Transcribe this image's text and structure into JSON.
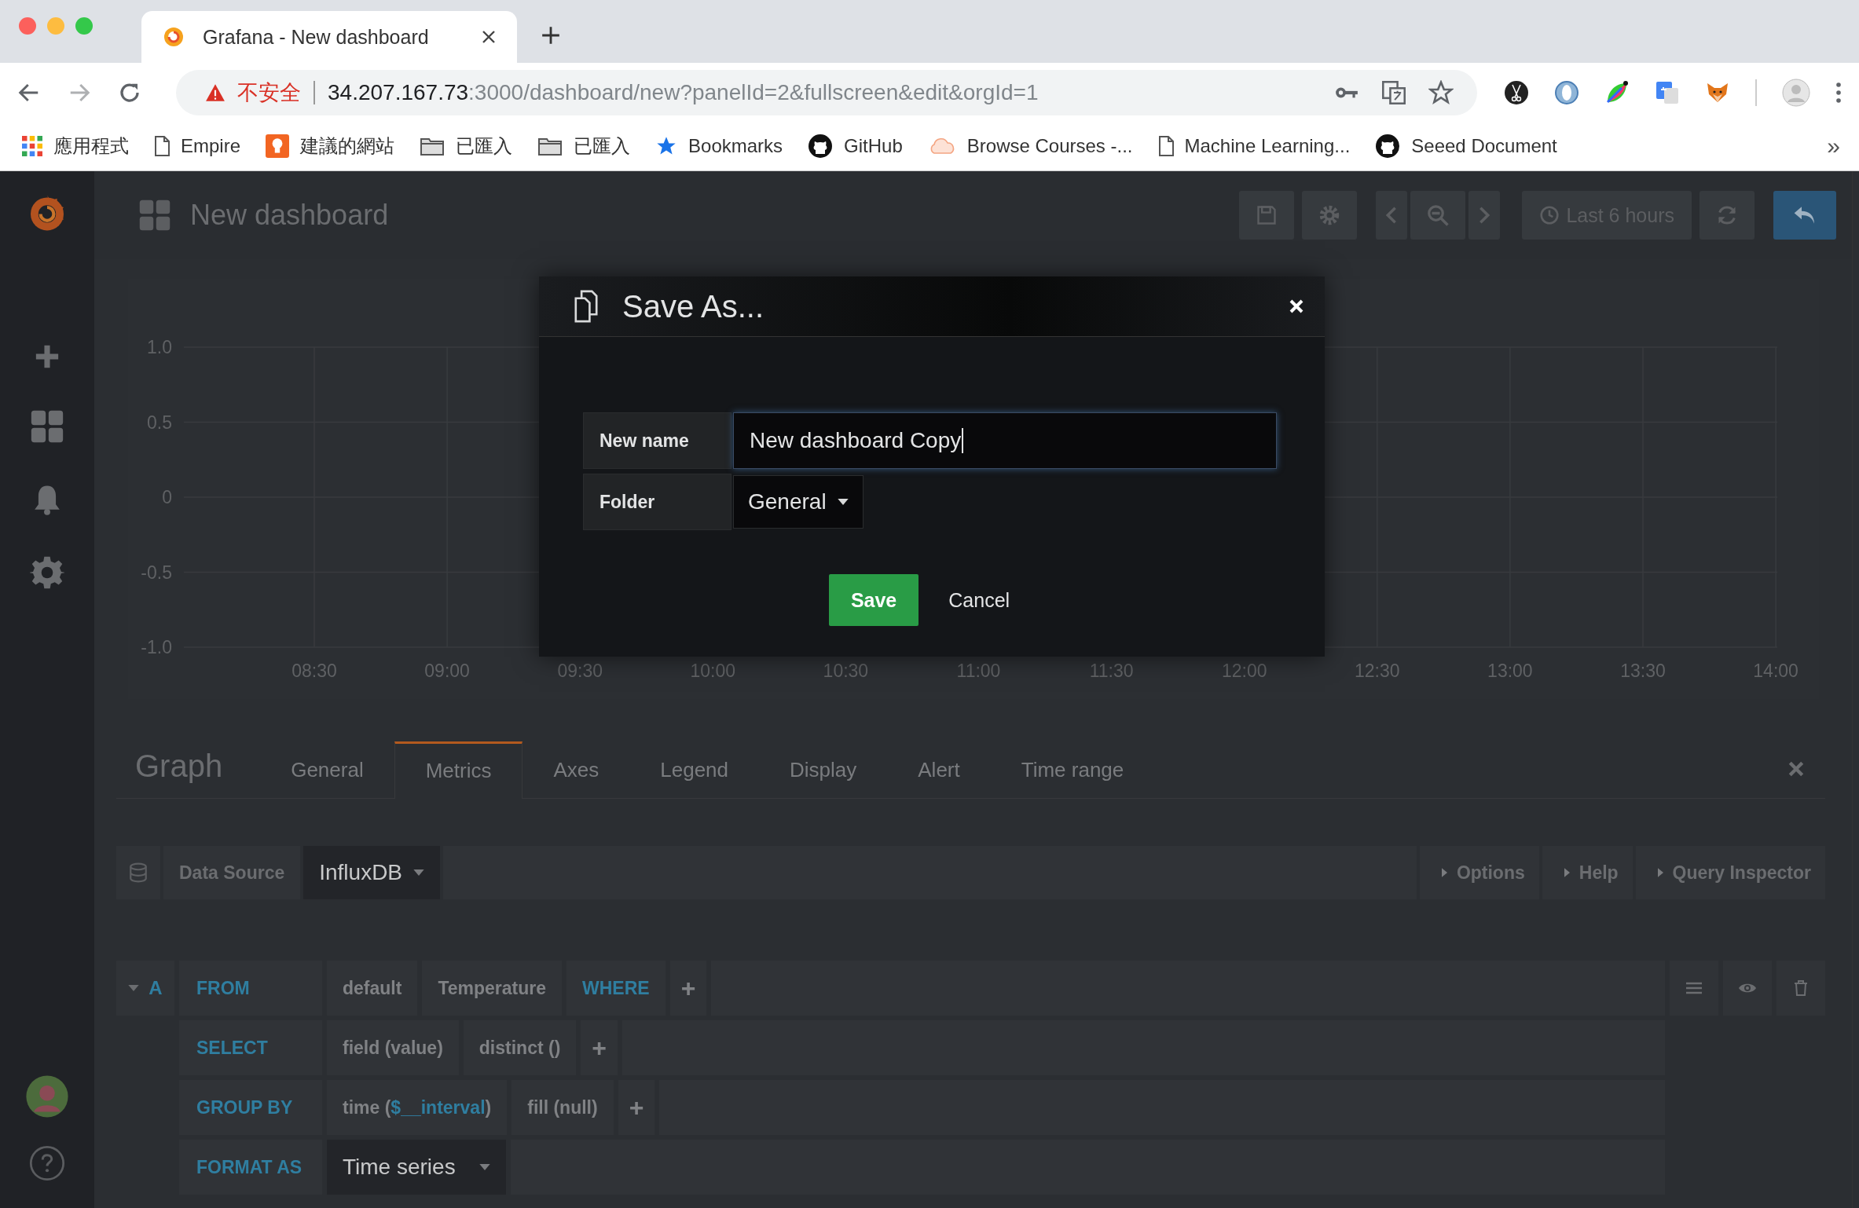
{
  "browser": {
    "tab": {
      "title": "Grafana - New dashboard"
    },
    "nav": {
      "back_disabled": false,
      "forward_disabled": true
    },
    "security": "不安全",
    "url_host": "34.207.167.73",
    "url_rest": ":3000/dashboard/new?panelId=2&fullscreen&edit&orgId=1",
    "bookmarks": [
      {
        "kind": "apps",
        "label": "應用程式"
      },
      {
        "kind": "page",
        "label": "Empire"
      },
      {
        "kind": "bulb",
        "label": "建議的網站"
      },
      {
        "kind": "folder",
        "label": "已匯入"
      },
      {
        "kind": "folder",
        "label": "已匯入"
      },
      {
        "kind": "star",
        "label": "Bookmarks"
      },
      {
        "kind": "github",
        "label": "GitHub"
      },
      {
        "kind": "cloud",
        "label": "Browse Courses -..."
      },
      {
        "kind": "page",
        "label": "Machine Learning..."
      },
      {
        "kind": "github",
        "label": "Seeed Document"
      }
    ],
    "more": "»"
  },
  "dashboard": {
    "title": "New dashboard",
    "time_range": "Last 6 hours"
  },
  "graph": {
    "y_labels": [
      "1.0",
      "0.5",
      "0",
      "-0.5",
      "-1.0"
    ],
    "x_labels": [
      "08:30",
      "09:00",
      "09:30",
      "10:00",
      "10:30",
      "11:00",
      "11:30",
      "12:00",
      "12:30",
      "13:00",
      "13:30",
      "14:00"
    ]
  },
  "editor": {
    "title": "Graph",
    "tabs": [
      {
        "label": "General",
        "selected": false
      },
      {
        "label": "Metrics",
        "selected": true
      },
      {
        "label": "Axes",
        "selected": false
      },
      {
        "label": "Legend",
        "selected": false
      },
      {
        "label": "Display",
        "selected": false
      },
      {
        "label": "Alert",
        "selected": false
      },
      {
        "label": "Time range",
        "selected": false
      }
    ],
    "data_source_label": "Data Source",
    "data_source": "InfluxDB",
    "toggles": [
      "Options",
      "Help",
      "Query Inspector"
    ],
    "query": {
      "ref": "A",
      "expanded": true,
      "rows": [
        {
          "label": "FROM",
          "items": [
            {
              "kind": "segment",
              "text": "default"
            },
            {
              "kind": "segment",
              "text": "Temperature"
            },
            {
              "kind": "keyword",
              "text": "WHERE"
            },
            {
              "kind": "add",
              "text": "+"
            }
          ]
        },
        {
          "label": "SELECT",
          "items": [
            {
              "kind": "segment",
              "text": "field (value)"
            },
            {
              "kind": "segment",
              "text": "distinct ()"
            },
            {
              "kind": "add",
              "text": "+"
            }
          ]
        },
        {
          "label": "GROUP BY",
          "items": [
            {
              "kind": "segment",
              "parts": [
                {
                  "text": "time (",
                  "variable": false
                },
                {
                  "text": "$__interval",
                  "variable": true
                },
                {
                  "text": ")",
                  "variable": false
                }
              ]
            },
            {
              "kind": "segment",
              "text": "fill (null)"
            },
            {
              "kind": "add",
              "text": "+"
            }
          ]
        },
        {
          "label": "FORMAT AS",
          "items": [
            {
              "kind": "select",
              "text": "Time series"
            }
          ]
        }
      ]
    }
  },
  "dialog": {
    "title": "Save As...",
    "fields": [
      {
        "kind": "text",
        "label": "New name",
        "value": "New dashboard Copy",
        "focused": true
      },
      {
        "kind": "select",
        "label": "Folder",
        "value": "General"
      }
    ],
    "buttons": [
      {
        "kind": "primary",
        "label": "Save"
      },
      {
        "kind": "link",
        "label": "Cancel"
      }
    ]
  }
}
